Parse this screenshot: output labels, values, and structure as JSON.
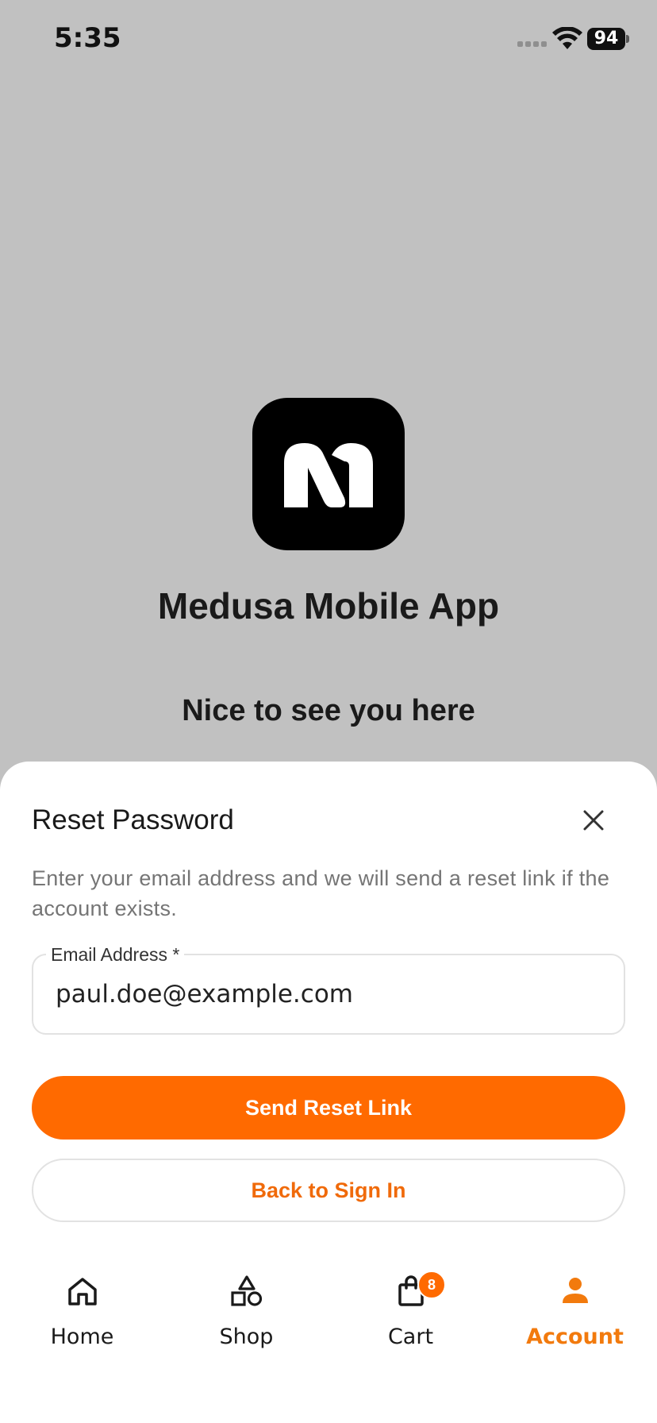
{
  "status_bar": {
    "time": "5:35",
    "battery": "94"
  },
  "hero": {
    "logo_icon": "medusa-m-logo-icon",
    "app_title": "Medusa Mobile App",
    "greeting": "Nice to see you here"
  },
  "reset_sheet": {
    "title": "Reset Password",
    "close_icon": "close-icon",
    "description": "Enter your email address and we will send a reset link if the account exists.",
    "email_field": {
      "label": "Email Address *",
      "value": "paul.doe@example.com"
    },
    "send_button_label": "Send Reset Link",
    "back_button_label": "Back to Sign In"
  },
  "tab_bar": {
    "tabs": [
      {
        "label": "Home",
        "icon": "home-icon",
        "active": false
      },
      {
        "label": "Shop",
        "icon": "shapes-icon",
        "active": false
      },
      {
        "label": "Cart",
        "icon": "shopping-bag-icon",
        "active": false,
        "badge": "8"
      },
      {
        "label": "Account",
        "icon": "user-icon",
        "active": true
      }
    ]
  },
  "colors": {
    "backdrop": "#c1c1c1",
    "accent": "#ff6a00",
    "accent_text": "#f06a0a",
    "sheet_background": "#ffffff"
  }
}
